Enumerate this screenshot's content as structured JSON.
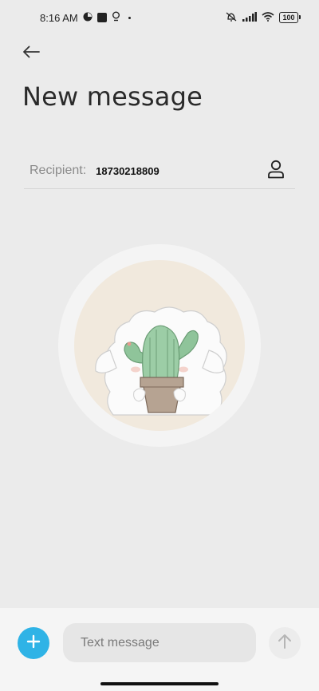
{
  "status_bar": {
    "time": "8:16 AM",
    "battery": "100",
    "icons": [
      "notification-icon",
      "stop-icon",
      "location-icon",
      "mute-icon",
      "signal-icon",
      "wifi-icon",
      "battery-icon"
    ]
  },
  "header": {
    "back_icon": "back-arrow-icon",
    "title": "New message"
  },
  "recipient": {
    "label": "Recipient:",
    "value": "18730218809",
    "contact_icon": "contact-icon"
  },
  "empty_state": {
    "illustration": "sheep-holding-cactus-illustration"
  },
  "composer": {
    "attach_icon": "plus-icon",
    "placeholder": "Text message",
    "value": "",
    "send_icon": "send-arrow-icon"
  },
  "colors": {
    "background": "#ebebeb",
    "accent": "#2fb3e6",
    "composer_bar": "#f5f5f5",
    "input_fill": "#e6e6e6"
  }
}
